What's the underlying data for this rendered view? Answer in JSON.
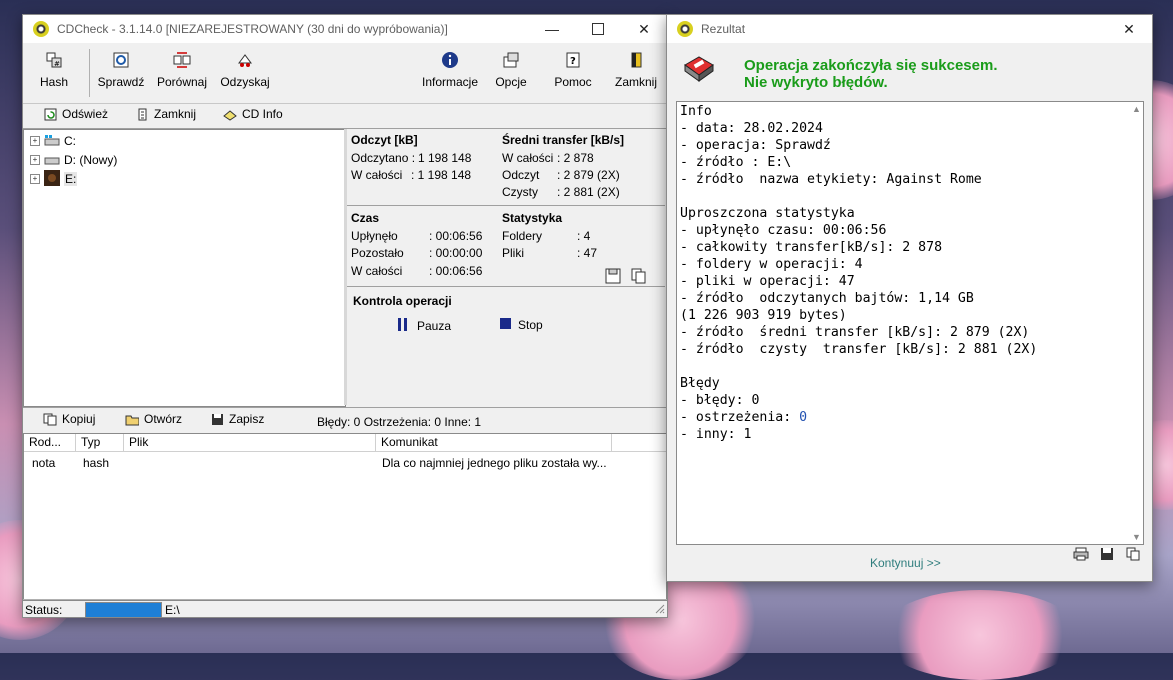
{
  "main_window": {
    "title": "CDCheck - 3.1.14.0 [NIEZAREJESTROWANY (30 dni do wypróbowania)]",
    "toolbar": {
      "hash": "Hash",
      "sprawdz": "Sprawdź",
      "porownaj": "Porównaj",
      "odzyskaj": "Odzyskaj",
      "informacje": "Informacje",
      "opcje": "Opcje",
      "pomoc": "Pomoc",
      "zamknij": "Zamknij"
    },
    "subbar": {
      "odswiez": "Odśwież",
      "zamknij": "Zamknij",
      "cdinfo": "CD Info"
    },
    "tree": [
      {
        "label": "C:",
        "icon": "drive-icon"
      },
      {
        "label": "D: (Nowy)",
        "icon": "drive-icon"
      },
      {
        "label": "E:",
        "icon": "disc-image-icon"
      }
    ],
    "stats": {
      "odczyt_title": "Odczyt [kB]",
      "odczytano_label": "Odczytano :",
      "odczytano_value": "1 198 148",
      "wcalosci_label": "W całości",
      "wcalosci_value": ": 1 198 148",
      "transfer_title": "Średni transfer [kB/s]",
      "t_wcalosci_label": "W całości",
      "t_wcalosci_value": ": 2 878",
      "t_odczyt_label": "Odczyt",
      "t_odczyt_value": ": 2 879 (2X)",
      "t_czysty_label": "Czysty",
      "t_czysty_value": ": 2 881 (2X)",
      "czas_title": "Czas",
      "uplynelo_label": "Upłynęło",
      "uplynelo_value": ": 00:06:56",
      "pozostalo_label": "Pozostało",
      "pozostalo_value": ": 00:00:00",
      "cz_wcalosci_label": "W całości",
      "cz_wcalosci_value": ": 00:06:56",
      "stat_title": "Statystyka",
      "foldery_label": "Foldery",
      "foldery_value": ": 4",
      "pliki_label": "Pliki",
      "pliki_value": ": 47"
    },
    "control": {
      "title": "Kontrola operacji",
      "pause": "Pauza",
      "stop": "Stop"
    },
    "log_bar": {
      "kopiuj": "Kopiuj",
      "otworz": "Otwórz",
      "zapisz": "Zapisz",
      "summary": "Błędy: 0 Ostrzeżenia: 0 Inne: 1"
    },
    "log_table": {
      "columns": [
        "Rod...",
        "Typ",
        "Plik",
        "Komunikat"
      ],
      "rows": [
        {
          "rod": "nota",
          "typ": "hash",
          "plik": "",
          "komunikat": "Dla co najmniej jednego pliku została wy..."
        }
      ]
    },
    "status": {
      "label": "Status:",
      "path": "E:\\",
      "progress": 1.0
    }
  },
  "result_window": {
    "title": "Rezultat",
    "headline1": "Operacja zakończyła się sukcesem.",
    "headline2": "Nie wykryto błędów.",
    "report_lines": [
      "Info",
      "- data: 28.02.2024",
      "- operacja: Sprawdź",
      "- źródło : E:\\",
      "- źródło  nazwa etykiety: Against Rome",
      "",
      "Uproszczona statystyka",
      "- upłynęło czasu: 00:06:56",
      "- całkowity transfer[kB/s]: 2 878",
      "- foldery w operacji: 4",
      "- pliki w operacji: 47",
      "- źródło  odczytanych bajtów: 1,14 GB",
      "(1 226 903 919 bytes)",
      "- źródło  średni transfer [kB/s]: 2 879 (2X)",
      "- źródło  czysty  transfer [kB/s]: 2 881 (2X)",
      "",
      "Błędy",
      "- błędy: 0",
      "- ostrzeżenia: 0",
      "- inny: 1"
    ],
    "continue": "Kontynuuj >>"
  },
  "colors": {
    "success_green": "#1a9c1a",
    "progress_blue": "#1e7fd6",
    "continue_teal": "#2f7d7d"
  }
}
